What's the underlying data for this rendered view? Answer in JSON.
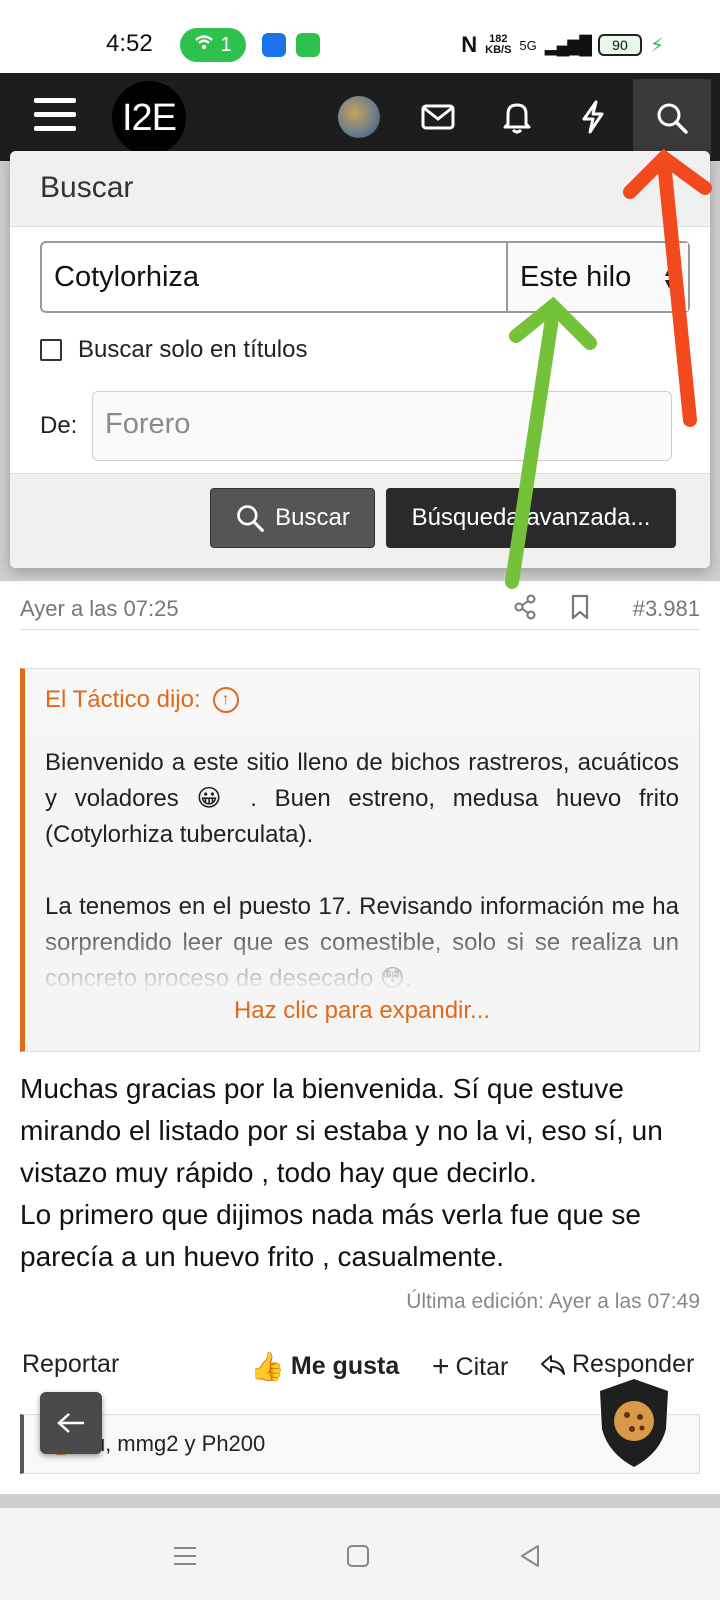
{
  "status_bar": {
    "time": "4:52",
    "hotspot_count": "1",
    "net_speed_value": "182",
    "net_speed_unit": "KB/S",
    "network_type": "5G",
    "battery": "90"
  },
  "app_bar": {
    "logo_text": "I2E",
    "icons": [
      "menu-icon",
      "avatar",
      "mail-icon",
      "bell-icon",
      "flash-icon",
      "search-icon"
    ]
  },
  "search_panel": {
    "title": "Buscar",
    "query": "Cotylorhiza",
    "scope": "Este hilo",
    "titles_only_label": "Buscar solo en títulos",
    "from_label": "De:",
    "from_placeholder": "Forero",
    "search_button": "Buscar",
    "advanced_button": "Búsqueda avanzada..."
  },
  "post": {
    "date": "Ayer a las 07:25",
    "number": "#3.981",
    "quote": {
      "author": "El Táctico dijo:",
      "paragraph1": "Bienvenido a este sitio lleno de bichos rastreros, acuáticos y voladores 😀 . Buen estreno, medusa huevo frito (Cotylorhiza tuberculata).",
      "paragraph2": "La tenemos en el puesto 17. Revisando información me ha sorprendido leer que es comestible, solo si se realiza un concreto proceso de desecado 😳.",
      "expand": "Haz clic para expandir..."
    },
    "body_line1": "Muchas gracias por la bienvenida. Sí que estuve mirando el listado por si estaba y no la vi, eso sí, un vistazo muy rápido , todo hay que decirlo.",
    "body_line2": "Lo primero que dijimos nada más verla fue que se parecía a un huevo frito , casualmente.",
    "last_edit": "Última edición: Ayer a las 07:49",
    "actions": {
      "report": "Reportar",
      "like": "Me gusta",
      "quote": "Citar",
      "reply": "Responder"
    },
    "reactions": "Tú, mmg2 y Ph200"
  },
  "colors": {
    "accent_orange": "#e06a1a",
    "annotation_red": "#f24a1e",
    "annotation_green": "#74c23a",
    "appbar_bg": "#1d1d1d"
  }
}
